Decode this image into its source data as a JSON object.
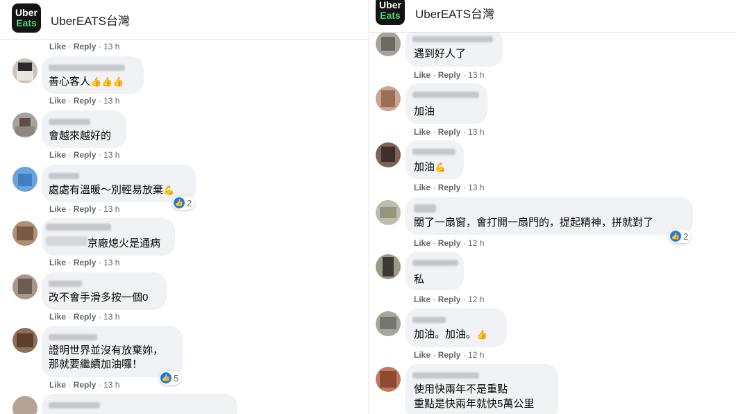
{
  "page": {
    "name": "UberEATS台灣",
    "logo_line1": "Uber",
    "logo_line2": "Eats"
  },
  "actions": {
    "like": "Like",
    "reply": "Reply",
    "dot": "·"
  },
  "left": {
    "comments": [
      {
        "time": "13 h"
      },
      {
        "text": "善心客人",
        "emoji": "👍👍👍",
        "time": "13 h"
      },
      {
        "text": "會越來越好的",
        "time": "13 h"
      },
      {
        "text": "處處有溫暖～別輕易放棄",
        "emoji": "💪",
        "time": "13 h",
        "reactions": "2"
      },
      {
        "text": "京廠熄火是通病",
        "time": "13 h"
      },
      {
        "text": "改不會手滑多按一個0",
        "time": "13 h"
      },
      {
        "line1": "證明世界並沒有放棄妳，",
        "line2": "那就要繼續加油囉！",
        "time": "13 h",
        "reactions": "5"
      }
    ]
  },
  "right": {
    "comments": [
      {
        "text": "遇到好人了",
        "time": "13 h"
      },
      {
        "text": "加油",
        "time": "13 h"
      },
      {
        "text": "加油",
        "emoji": "💪",
        "time": "13 h"
      },
      {
        "text": "關了一扇窗，會打開一扇門的，提起精神，拼就對了",
        "time": "12 h",
        "reactions": "2"
      },
      {
        "text": "私",
        "time": "12 h"
      },
      {
        "text": "加油。加油。",
        "emoji": "👍",
        "time": "12 h"
      },
      {
        "line1": "使用快兩年不是重點",
        "line2": "重點是快兩年就快5萬公里"
      }
    ]
  }
}
